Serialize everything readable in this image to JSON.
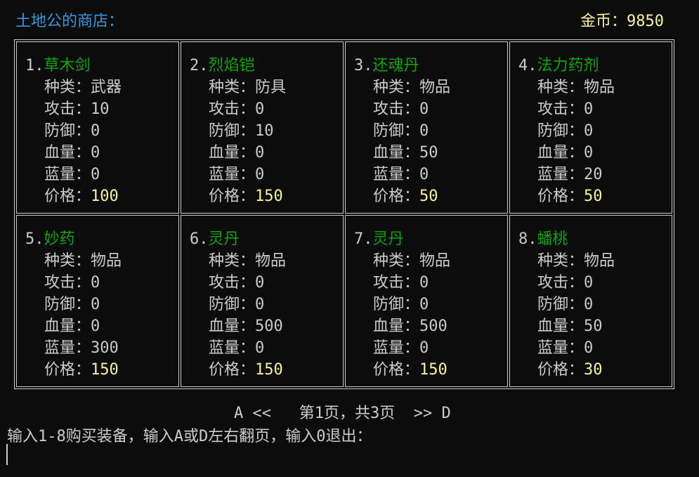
{
  "header": {
    "shop_title": "土地公的商店：",
    "gold_label": "金币：",
    "gold_value": "9850"
  },
  "labels": {
    "type": "种类：",
    "attack": "攻击：",
    "defense": "防御：",
    "hp": "血量：",
    "mp": "蓝量：",
    "price": "价格："
  },
  "items": [
    {
      "num": "1.",
      "name": "草木剑",
      "type": "武器",
      "attack": "10",
      "defense": "0",
      "hp": "0",
      "mp": "0",
      "price": "100"
    },
    {
      "num": "2.",
      "name": "烈焰铠",
      "type": "防具",
      "attack": "0",
      "defense": "10",
      "hp": "0",
      "mp": "0",
      "price": "150"
    },
    {
      "num": "3.",
      "name": "还魂丹",
      "type": "物品",
      "attack": "0",
      "defense": "0",
      "hp": "50",
      "mp": "0",
      "price": "50"
    },
    {
      "num": "4.",
      "name": "法力药剂",
      "type": "物品",
      "attack": "0",
      "defense": "0",
      "hp": "0",
      "mp": "20",
      "price": "50"
    },
    {
      "num": "5.",
      "name": "妙药",
      "type": "物品",
      "attack": "0",
      "defense": "0",
      "hp": "0",
      "mp": "300",
      "price": "150"
    },
    {
      "num": "6.",
      "name": "灵丹",
      "type": "物品",
      "attack": "0",
      "defense": "0",
      "hp": "500",
      "mp": "0",
      "price": "150"
    },
    {
      "num": "7.",
      "name": "灵丹",
      "type": "物品",
      "attack": "0",
      "defense": "0",
      "hp": "500",
      "mp": "0",
      "price": "150"
    },
    {
      "num": "8.",
      "name": "蟠桃",
      "type": "物品",
      "attack": "0",
      "defense": "0",
      "hp": "50",
      "mp": "0",
      "price": "30"
    }
  ],
  "pager": {
    "prev": "A <<",
    "page_text": "第1页，共3页",
    "next": ">> D"
  },
  "prompt": "输入1-8购买装备，输入A或D左右翻页，输入0退出：",
  "colors": {
    "title": "#3a96dd",
    "item_name": "#13a10e",
    "price": "#f9f1a5",
    "text": "#cccccc",
    "background": "#0c0c0c"
  }
}
